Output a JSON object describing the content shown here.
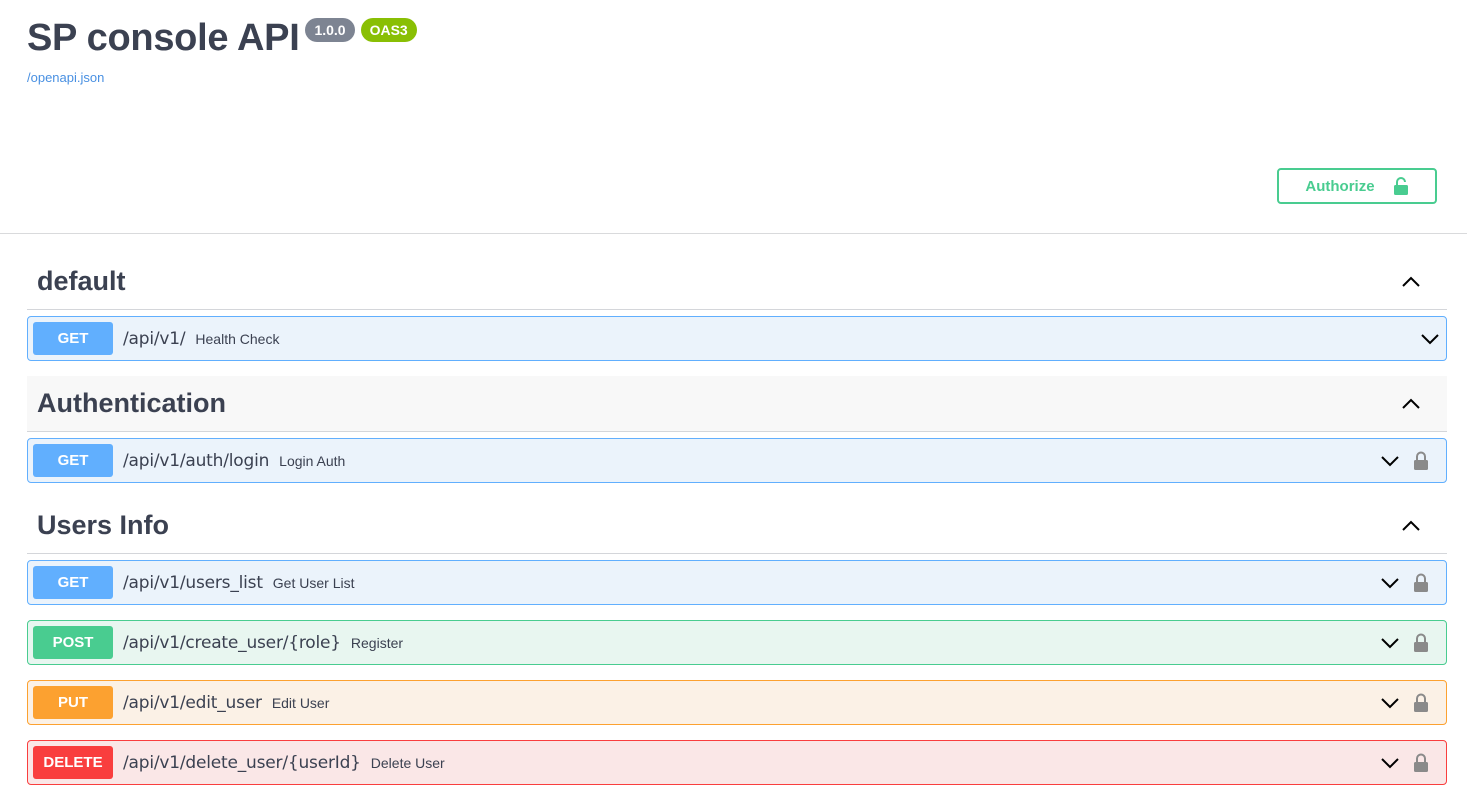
{
  "header": {
    "title": "SP console API",
    "version_badge": "1.0.0",
    "oas_badge": "OAS3",
    "spec_link": "/openapi.json",
    "authorize_label": "Authorize"
  },
  "sections": [
    {
      "name": "default",
      "operations": [
        {
          "method": "GET",
          "path": "/api/v1/",
          "summary": "Health Check",
          "locked": false
        }
      ]
    },
    {
      "name": "Authentication",
      "operations": [
        {
          "method": "GET",
          "path": "/api/v1/auth/login",
          "summary": "Login Auth",
          "locked": true
        }
      ]
    },
    {
      "name": "Users Info",
      "operations": [
        {
          "method": "GET",
          "path": "/api/v1/users_list",
          "summary": "Get User List",
          "locked": true
        },
        {
          "method": "POST",
          "path": "/api/v1/create_user/{role}",
          "summary": "Register",
          "locked": true
        },
        {
          "method": "PUT",
          "path": "/api/v1/edit_user",
          "summary": "Edit User",
          "locked": true
        },
        {
          "method": "DELETE",
          "path": "/api/v1/delete_user/{userId}",
          "summary": "Delete User",
          "locked": true
        }
      ]
    }
  ],
  "colors": {
    "get": "#61affe",
    "post": "#49cc90",
    "put": "#fca130",
    "delete": "#f93e3e",
    "accent": "#49cc90"
  }
}
